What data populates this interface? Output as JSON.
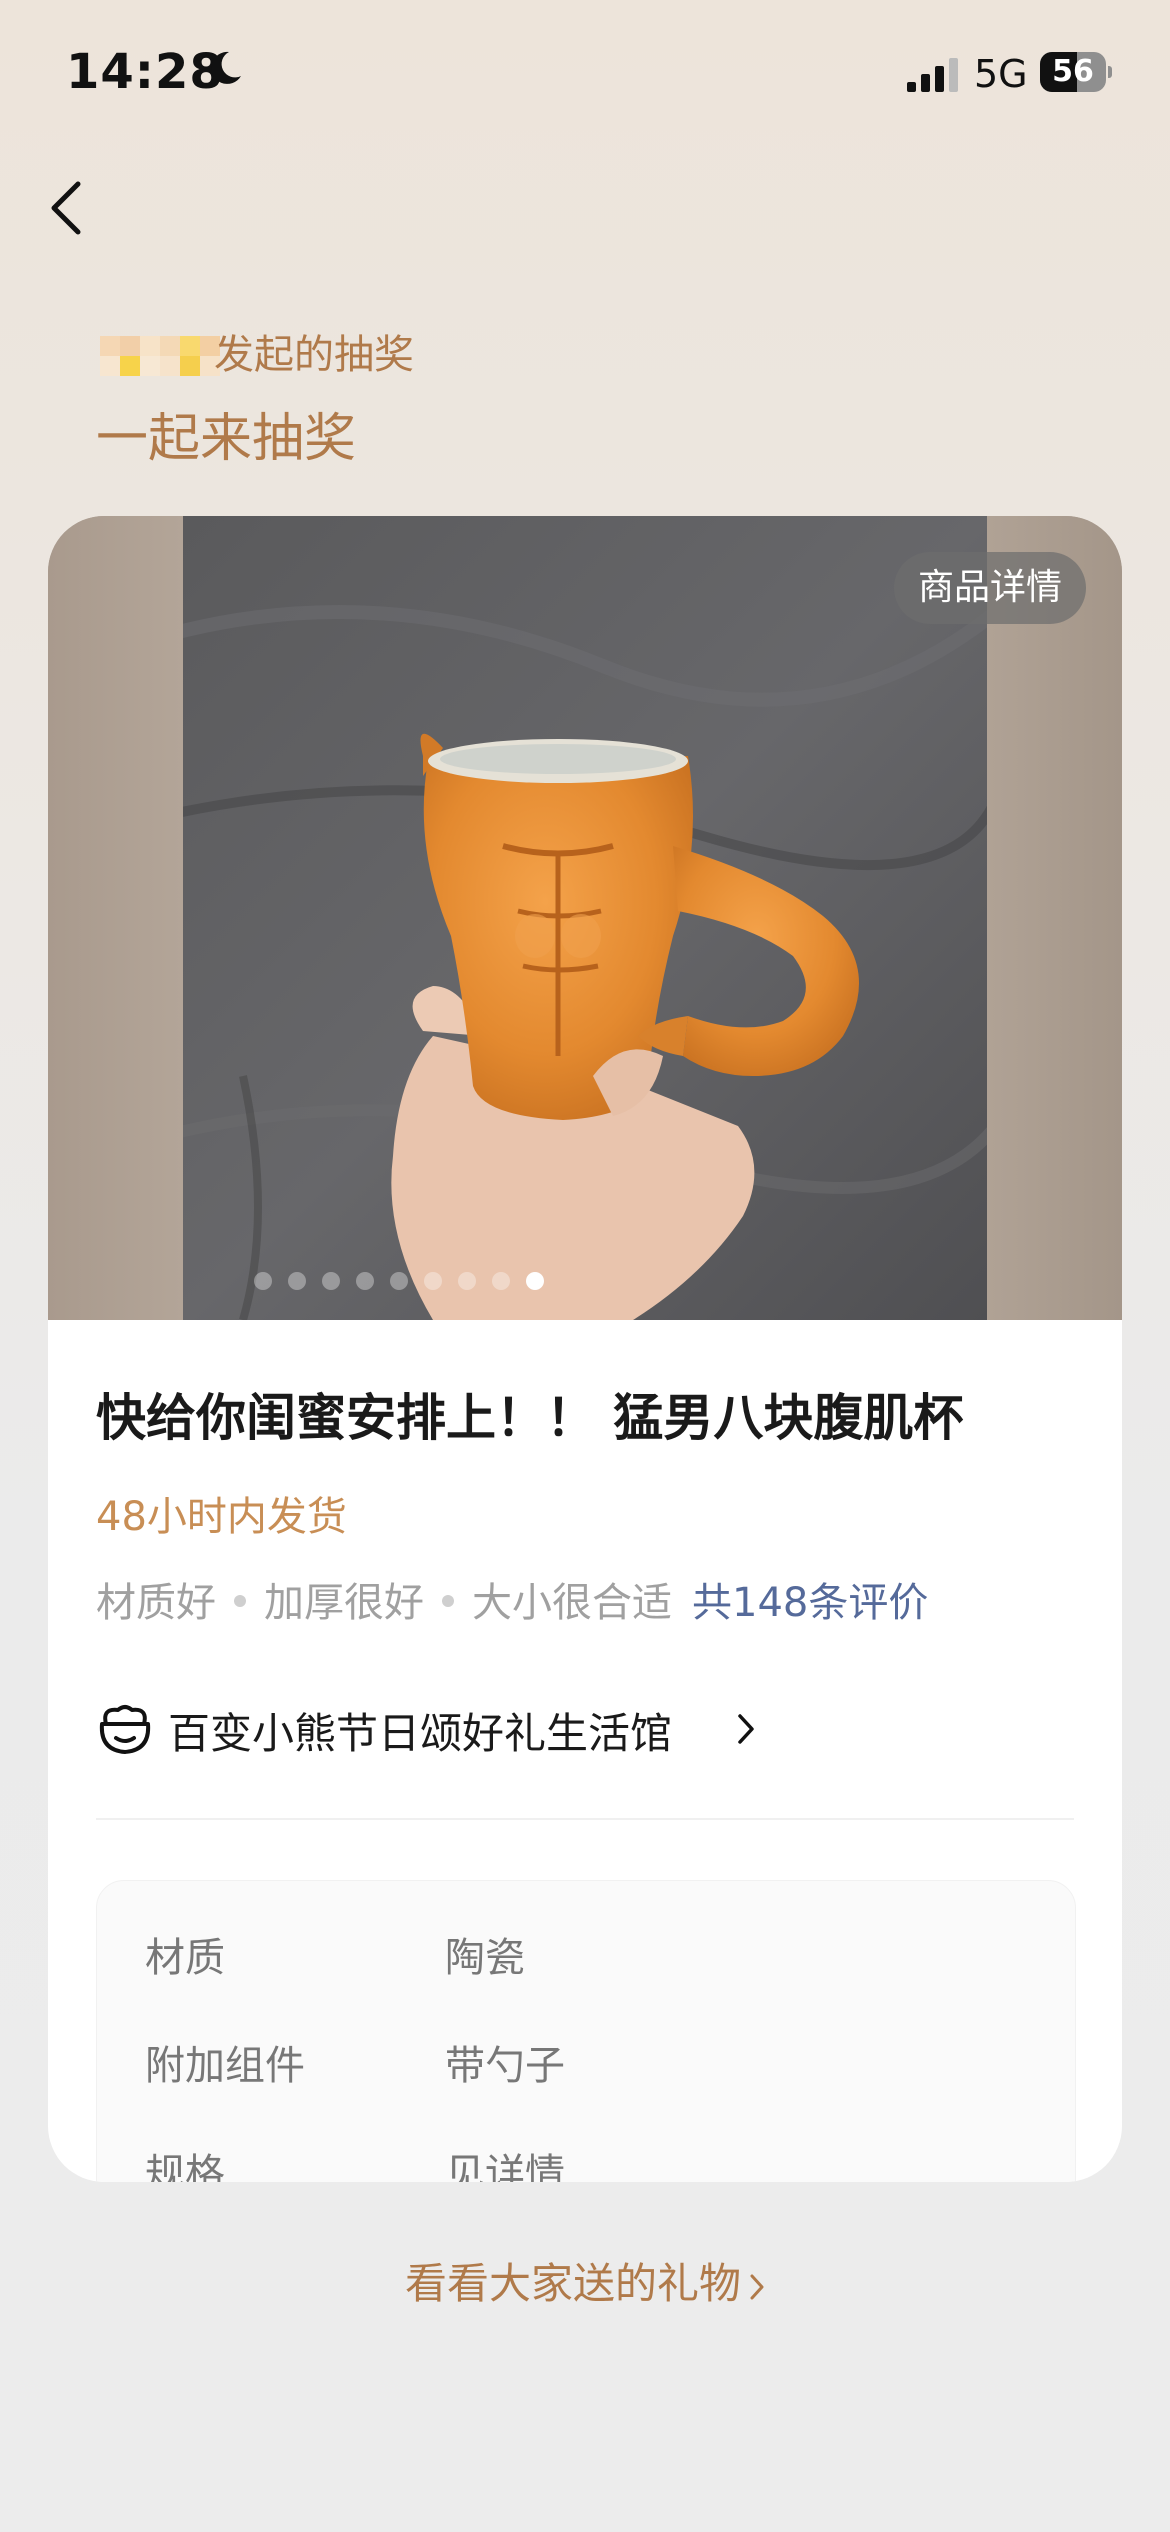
{
  "status_bar": {
    "time": "14:28",
    "network": "5G",
    "battery": "56"
  },
  "header": {
    "initiator_suffix": "发起的抽奖",
    "subtitle": "一起来抽奖"
  },
  "product": {
    "detail_button": "商品详情",
    "carousel_total": 9,
    "carousel_active": 9,
    "title": "快给你闺蜜安排上！！ 猛男八块腹肌杯",
    "shipping": "48小时内发货",
    "tags": [
      "材质好",
      "加厚很好",
      "大小很合适"
    ],
    "reviews": "共148条评价",
    "shop_name": "百变小熊节日颂好礼生活馆",
    "specs": [
      {
        "key": "材质",
        "value": "陶瓷"
      },
      {
        "key": "附加组件",
        "value": "带勺子"
      },
      {
        "key": "规格",
        "value": "见详情"
      }
    ]
  },
  "footer_link": "看看大家送的礼物",
  "colors": {
    "accent": "#b07a4a",
    "shipping": "#c88e55",
    "reviews": "#556a9a",
    "mug": "#e38b33"
  },
  "icons": [
    "moon-icon",
    "signal-icon",
    "battery-icon",
    "back-arrow-icon",
    "shop-bear-icon",
    "chevron-right-icon"
  ]
}
